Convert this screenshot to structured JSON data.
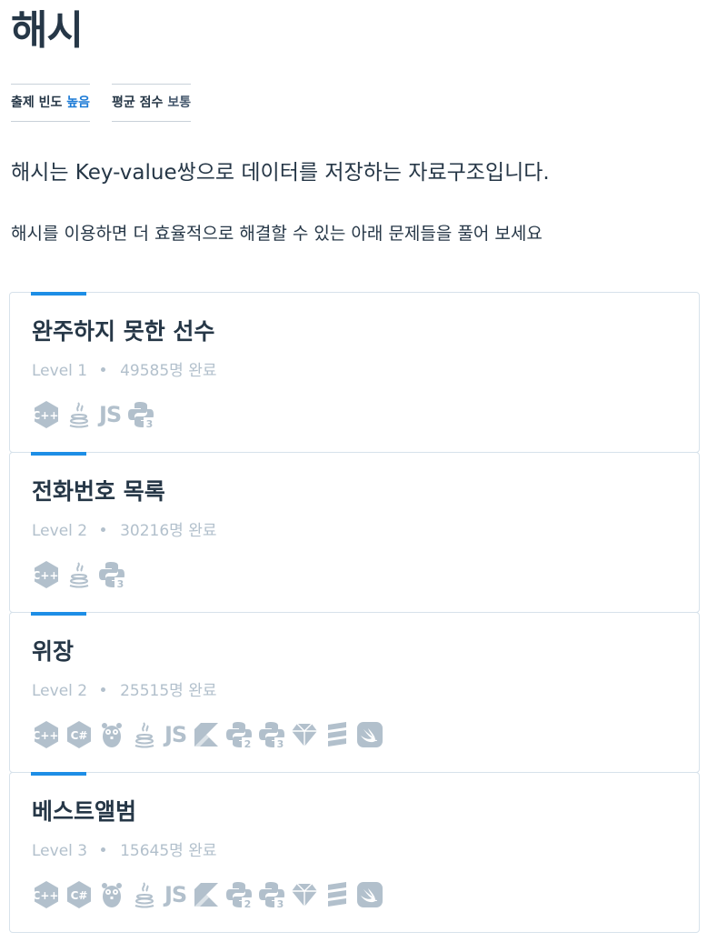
{
  "page": {
    "title": "해시",
    "stats": [
      {
        "label": "출제 빈도",
        "value": "높음"
      },
      {
        "label": "평균 점수",
        "value": "보통"
      }
    ],
    "lead": "해시는 Key-value쌍으로 데이터를 저장하는 자료구조입니다.",
    "sub": "해시를 이용하면 더 효율적으로 해결할 수 있는 아래 문제들을 풀어 보세요"
  },
  "colors": {
    "accent": "#1e8ee6",
    "high": "#1d7bd6",
    "text": "#263747",
    "muted": "#b2c0cc"
  },
  "problems": [
    {
      "title": "완주하지 못한 선수",
      "level": "Level 1",
      "completed": "49585명 완료",
      "languages": [
        "cpp-icon",
        "java-icon",
        "javascript-icon",
        "python3-icon"
      ],
      "js_label": "JS"
    },
    {
      "title": "전화번호 목록",
      "level": "Level 2",
      "completed": "30216명 완료",
      "languages": [
        "cpp-icon",
        "java-icon",
        "python3-icon"
      ]
    },
    {
      "title": "위장",
      "level": "Level 2",
      "completed": "25515명 완료",
      "languages": [
        "cpp-icon",
        "csharp-icon",
        "go-icon",
        "java-icon",
        "javascript-icon",
        "kotlin-icon",
        "python2-icon",
        "python3-icon",
        "ruby-icon",
        "scala-icon",
        "swift-icon"
      ],
      "js_label": "JS"
    },
    {
      "title": "베스트앨범",
      "level": "Level 3",
      "completed": "15645명 완료",
      "languages": [
        "cpp-icon",
        "csharp-icon",
        "go-icon",
        "java-icon",
        "javascript-icon",
        "kotlin-icon",
        "python2-icon",
        "python3-icon",
        "ruby-icon",
        "scala-icon",
        "swift-icon"
      ],
      "js_label": "JS"
    }
  ]
}
